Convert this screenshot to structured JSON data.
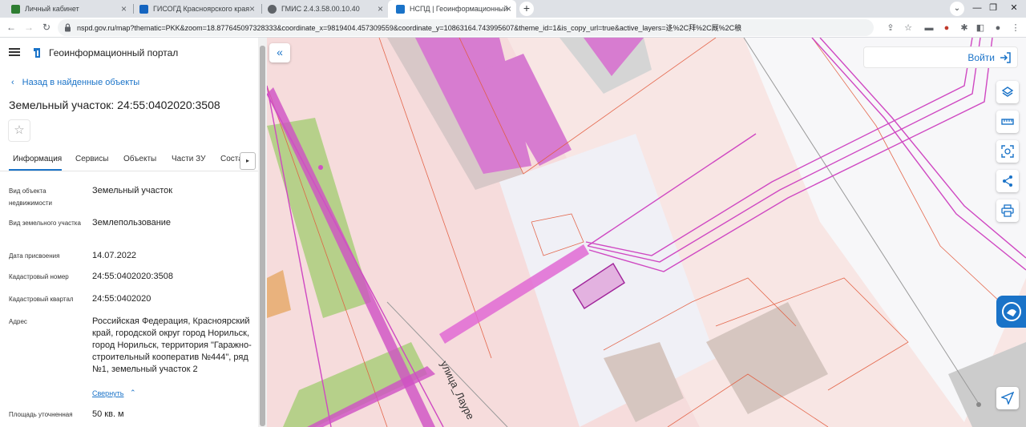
{
  "browser": {
    "tabs": [
      {
        "title": "Личный кабинет",
        "fav_color": "#2e7d32"
      },
      {
        "title": "ГИСОГД Красноярского края",
        "fav_color": "#1565c0"
      },
      {
        "title": "ГМИС 2.4.3.58.00.10.40",
        "fav_color": "#5f6368"
      },
      {
        "title": "НСПД | Геоинформационный п",
        "fav_color": "#1a73c8"
      }
    ],
    "new_tab": "+",
    "url": "nspd.gov.ru/map?thematic=PKK&zoom=18.877645097328333&coordinate_x=9819404.457309559&coordinate_y=10863164.743995607&theme_id=1&is_copy_url=true&active_layers=迻%2C拜%2C厩%2C稂"
  },
  "panel": {
    "portal_title": "Геоинформационный портал",
    "back_label": "Назад в найденные объекты",
    "object_title": "Земельный участок: 24:55:0402020:3508",
    "tabs": [
      {
        "label": "Информация"
      },
      {
        "label": "Сервисы"
      },
      {
        "label": "Объекты"
      },
      {
        "label": "Части ЗУ"
      },
      {
        "label": "Соста"
      }
    ],
    "fields": [
      {
        "label": "Вид объекта недвижимости",
        "value": "Земельный участок"
      },
      {
        "label": "Вид земельного участка",
        "value": "Землепользование"
      },
      {
        "label": "Дата присвоения",
        "value": "14.07.2022"
      },
      {
        "label": "Кадастровый номер",
        "value": "24:55:0402020:3508"
      },
      {
        "label": "Кадастровый квартал",
        "value": "24:55:0402020"
      },
      {
        "label": "Адрес",
        "value": "Российская Федерация, Красноярский край, городской округ город Норильск, город Норильск, территория \"Гаражно-строительный кооператив №444\", ряд №1, земельный участок 2"
      },
      {
        "label": "Площадь уточненная",
        "value": "50 кв. м"
      }
    ],
    "collapse_label": "Свернуть"
  },
  "map": {
    "login_label": "Войти",
    "street_label": "улица_Лауре",
    "accent": "#1a73c8"
  }
}
